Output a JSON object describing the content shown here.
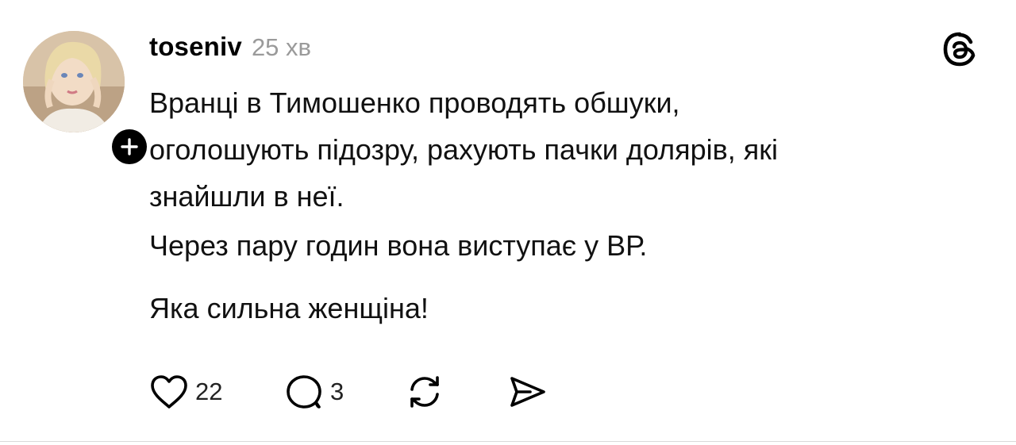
{
  "post": {
    "username": "toseniv",
    "time": "25 хв",
    "paragraphs": [
      "Вранці в Тимошенко проводять обшуки,\nоголошують підозру, рахують пачки долярів, які\nзнайшли в неї.",
      "Через пару годин вона виступає у ВР.",
      "Яка сильна женщіна!"
    ],
    "likes": "22",
    "replies": "3"
  },
  "icons": {
    "follow": "plus-icon",
    "logo": "threads-logo-icon",
    "like": "heart-icon",
    "reply": "comment-icon",
    "repost": "repost-icon",
    "share": "send-icon"
  },
  "colors": {
    "text": "#000000",
    "muted": "#9a9a9a",
    "badge": "#000000"
  }
}
